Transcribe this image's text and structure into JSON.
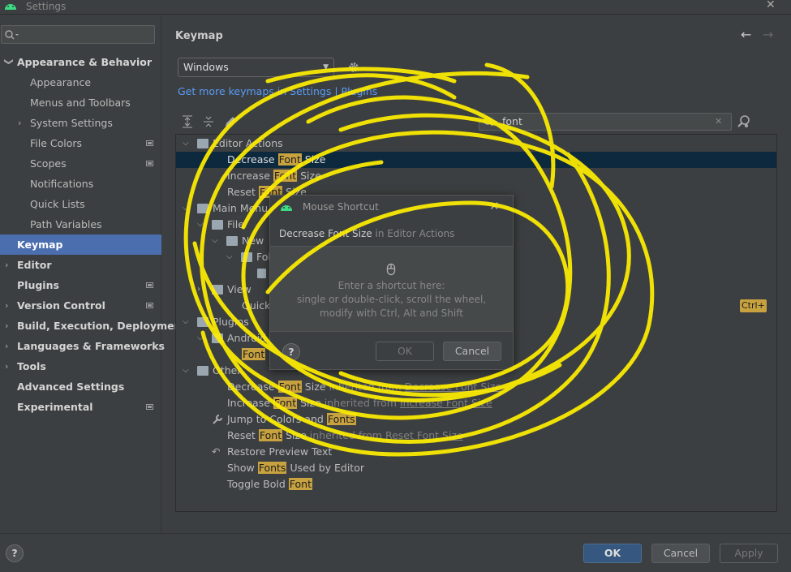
{
  "window": {
    "title": "Settings",
    "close": "✕"
  },
  "sidebar": {
    "search_placeholder": "Q▾",
    "items": [
      {
        "label": "Appearance & Behavior",
        "arrow": "❯",
        "bold": true
      },
      {
        "label": "Appearance"
      },
      {
        "label": "Menus and Toolbars"
      },
      {
        "label": "System Settings",
        "arrow": "›"
      },
      {
        "label": "File Colors"
      },
      {
        "label": "Scopes"
      },
      {
        "label": "Notifications"
      },
      {
        "label": "Quick Lists"
      },
      {
        "label": "Path Variables"
      },
      {
        "label": "Keymap",
        "selected": true
      },
      {
        "label": "Editor",
        "arrow": "›"
      },
      {
        "label": "Plugins"
      },
      {
        "label": "Version Control",
        "arrow": "›"
      },
      {
        "label": "Build, Execution, Deployment",
        "arrow": "›"
      },
      {
        "label": "Languages & Frameworks",
        "arrow": "›"
      },
      {
        "label": "Tools",
        "arrow": "›"
      },
      {
        "label": "Advanced Settings"
      },
      {
        "label": "Experimental"
      }
    ]
  },
  "main": {
    "title": "Keymap",
    "back": "←",
    "forward": "→",
    "keymap_value": "Windows",
    "more_keymaps_link": "Get more keymaps in Settings | Plugins",
    "filter_value": "font",
    "filter_clear": "✕",
    "highlight_word_font": "Font",
    "shortcut_badge": "Ctrl+"
  },
  "tree": {
    "editor_actions": "Editor Actions",
    "decrease_font_size": "Decrease",
    "increase": "Increase",
    "reset": "Reset",
    "size": "Size",
    "main_menu": "Main Menu",
    "file": "File",
    "new": "New",
    "folder": "Fol",
    "view": "View",
    "quick": "Quick",
    "plugins": "Plugins",
    "android": "Android",
    "other": "Other",
    "inherited_from": "inherited from",
    "decrease_link": "Decrease Font Size",
    "increase_link": "Increase Font Size",
    "reset_link": "Reset Font Size",
    "jump_to_colors": "Jump to Colors and",
    "fonts": "Fonts",
    "restore_preview": "Restore Preview Text",
    "show": "Show",
    "used_by_editor": "Used by Editor",
    "toggle_bold": "Toggle Bold"
  },
  "dialog": {
    "title": "Mouse Shortcut",
    "close": "✕",
    "action_name": "Decrease Font Size",
    "action_context": "in Editor Actions",
    "msg_line1": "Enter a shortcut here:",
    "msg_line2": "single or double-click, scroll the wheel,",
    "msg_line3": "modify with Ctrl, Alt and Shift",
    "help": "?",
    "ok": "OK",
    "cancel": "Cancel"
  },
  "footer": {
    "help": "?",
    "ok": "OK",
    "cancel": "Cancel",
    "apply": "Apply"
  },
  "colors": {
    "scribble": "#ffee00",
    "selected_nav": "#4b6eaf",
    "highlight": "#c8a23f",
    "link": "#589df6"
  }
}
